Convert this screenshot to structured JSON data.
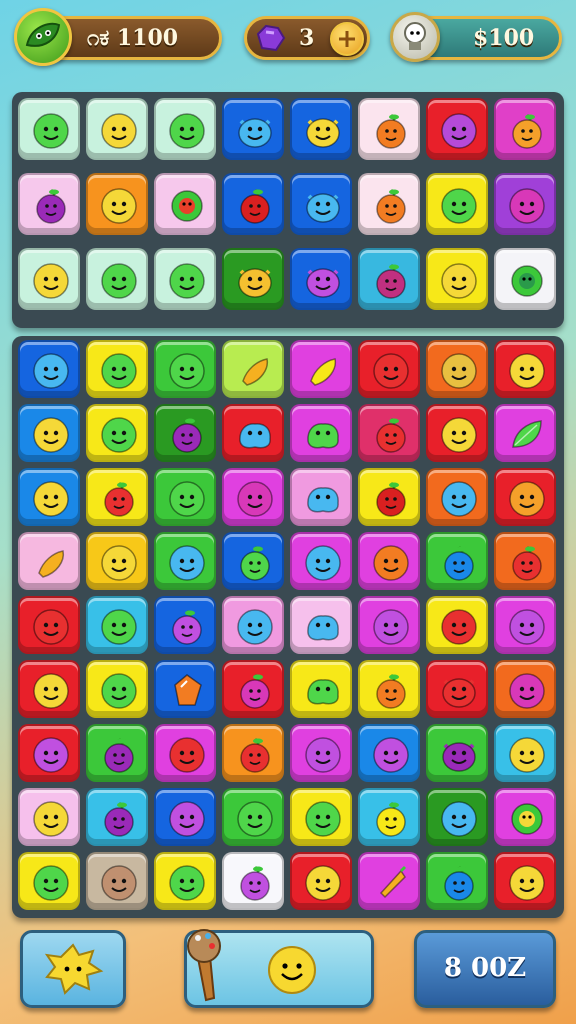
{
  "hud": {
    "coins_value": "೧ಕ 1100",
    "gems_value": "3",
    "score_value": "$100",
    "leaf_icon": "leaf-icon",
    "gem_icon": "purple-gem-icon",
    "plus_icon": "plus-icon",
    "bulb_icon": "lightbulb-icon"
  },
  "top_board": {
    "columns": 8,
    "tiles": [
      {
        "color": "#c8f2de",
        "face": "smiley",
        "fc": "#4fd64a"
      },
      {
        "color": "#c8f2de",
        "face": "smiley",
        "fc": "#f5d838"
      },
      {
        "color": "#c8f2de",
        "face": "smiley",
        "fc": "#4fd64a"
      },
      {
        "color": "#1565e0",
        "face": "monster",
        "fc": "#48b8f0"
      },
      {
        "color": "#1565e0",
        "face": "monster",
        "fc": "#f5d838"
      },
      {
        "color": "#fbe4ee",
        "face": "fruit",
        "fc": "#f27c22"
      },
      {
        "color": "#e8202a",
        "face": "smiley",
        "fc": "#b64ad8"
      },
      {
        "color": "#e040c8",
        "face": "fruit",
        "fc": "#f5a02a"
      },
      {
        "color": "#f6c8ec",
        "face": "fruit",
        "fc": "#9a2ab8"
      },
      {
        "color": "#f7931e",
        "face": "smiley",
        "fc": "#f5d838"
      },
      {
        "color": "#f6c8ec",
        "face": "flower",
        "fc": "#e8402a"
      },
      {
        "color": "#1565e0",
        "face": "fruit",
        "fc": "#d92020"
      },
      {
        "color": "#1565e0",
        "face": "monster",
        "fc": "#48b8f0"
      },
      {
        "color": "#fbe4ee",
        "face": "fruit",
        "fc": "#f27c22"
      },
      {
        "color": "#f7e818",
        "face": "smiley",
        "fc": "#4fd64a"
      },
      {
        "color": "#a040d8",
        "face": "smiley",
        "fc": "#d838b8"
      },
      {
        "color": "#c8f2de",
        "face": "smiley",
        "fc": "#f5d838"
      },
      {
        "color": "#c8f2de",
        "face": "smiley",
        "fc": "#4fd64a"
      },
      {
        "color": "#c8f2de",
        "face": "smiley",
        "fc": "#4fd64a"
      },
      {
        "color": "#2a9a22",
        "face": "monster",
        "fc": "#f5c030"
      },
      {
        "color": "#1565e0",
        "face": "monster",
        "fc": "#c050e0"
      },
      {
        "color": "#38b8e0",
        "face": "fruit",
        "fc": "#c03080"
      },
      {
        "color": "#f7e818",
        "face": "smiley",
        "fc": "#f5d838"
      },
      {
        "color": "#f4f4f8",
        "face": "flower",
        "fc": "#2a9a4a"
      }
    ]
  },
  "main_board": {
    "columns": 8,
    "tiles": [
      {
        "color": "#1565e0",
        "face": "smiley",
        "fc": "#48b8f0"
      },
      {
        "color": "#f7e818",
        "face": "smiley",
        "fc": "#4fd64a"
      },
      {
        "color": "#3cc83a",
        "face": "smiley",
        "fc": "#4fd64a"
      },
      {
        "color": "#b8ec50",
        "face": "banana",
        "fc": "#f5b020"
      },
      {
        "color": "#e040e0",
        "face": "banana",
        "fc": "#f7e818"
      },
      {
        "color": "#e8202a",
        "face": "smiley",
        "fc": "#e83030"
      },
      {
        "color": "#f26a1e",
        "face": "smiley",
        "fc": "#e8c040"
      },
      {
        "color": "#e8202a",
        "face": "smiley",
        "fc": "#f5d838"
      },
      {
        "color": "#1a88e8",
        "face": "smiley",
        "fc": "#f5d838"
      },
      {
        "color": "#f7e818",
        "face": "smiley",
        "fc": "#4fd64a"
      },
      {
        "color": "#2a9a22",
        "face": "fruit",
        "fc": "#9a2ab8"
      },
      {
        "color": "#e8202a",
        "face": "blob",
        "fc": "#48b8f0"
      },
      {
        "color": "#e040e0",
        "face": "blob",
        "fc": "#4fd64a"
      },
      {
        "color": "#e0306a",
        "face": "fruit",
        "fc": "#e83030"
      },
      {
        "color": "#e8202a",
        "face": "smiley",
        "fc": "#f5d838"
      },
      {
        "color": "#e040e0",
        "face": "leaf",
        "fc": "#4fd64a"
      },
      {
        "color": "#1a88e8",
        "face": "smiley",
        "fc": "#f5d838"
      },
      {
        "color": "#f7e818",
        "face": "fruit",
        "fc": "#e83030"
      },
      {
        "color": "#3cc83a",
        "face": "smiley",
        "fc": "#4fd64a"
      },
      {
        "color": "#e040e0",
        "face": "smiley",
        "fc": "#d838b8"
      },
      {
        "color": "#f09ae0",
        "face": "blob",
        "fc": "#48b8f0"
      },
      {
        "color": "#f7e818",
        "face": "fruit",
        "fc": "#d92020"
      },
      {
        "color": "#f26a1e",
        "face": "smiley",
        "fc": "#48b8f0"
      },
      {
        "color": "#e8202a",
        "face": "smiley",
        "fc": "#f5a02a"
      },
      {
        "color": "#f6b8e0",
        "face": "banana",
        "fc": "#f5b020"
      },
      {
        "color": "#f7c818",
        "face": "smiley",
        "fc": "#f5d838"
      },
      {
        "color": "#3cc83a",
        "face": "smiley",
        "fc": "#48b8f0"
      },
      {
        "color": "#1565e0",
        "face": "fruit",
        "fc": "#4fd64a"
      },
      {
        "color": "#e040e0",
        "face": "smiley",
        "fc": "#48b8f0"
      },
      {
        "color": "#e040e0",
        "face": "smiley",
        "fc": "#f27c22"
      },
      {
        "color": "#3cc83a",
        "face": "fruit",
        "fc": "#1a88e8"
      },
      {
        "color": "#f26a1e",
        "face": "fruit",
        "fc": "#e83030"
      },
      {
        "color": "#e8202a",
        "face": "smiley",
        "fc": "#e83030"
      },
      {
        "color": "#38c0e8",
        "face": "smiley",
        "fc": "#4fd64a"
      },
      {
        "color": "#1565e0",
        "face": "fruit",
        "fc": "#c050e0"
      },
      {
        "color": "#f09ae0",
        "face": "smiley",
        "fc": "#48b8f0"
      },
      {
        "color": "#f6c0ec",
        "face": "blob",
        "fc": "#48b8f0"
      },
      {
        "color": "#e040e0",
        "face": "smiley",
        "fc": "#c050e0"
      },
      {
        "color": "#f7e818",
        "face": "smiley",
        "fc": "#e83030"
      },
      {
        "color": "#e040e0",
        "face": "smiley",
        "fc": "#c050e0"
      },
      {
        "color": "#e8202a",
        "face": "smiley",
        "fc": "#f5d838"
      },
      {
        "color": "#f7e818",
        "face": "smiley",
        "fc": "#4fd64a"
      },
      {
        "color": "#1565e0",
        "face": "gem",
        "fc": "#f27c22"
      },
      {
        "color": "#e8202a",
        "face": "fruit",
        "fc": "#d838b8"
      },
      {
        "color": "#f7e818",
        "face": "blob",
        "fc": "#4fd64a"
      },
      {
        "color": "#f7e818",
        "face": "fruit",
        "fc": "#f27c22"
      },
      {
        "color": "#e8202a",
        "face": "monster",
        "fc": "#e83030"
      },
      {
        "color": "#f26a1e",
        "face": "smiley",
        "fc": "#d838b8"
      },
      {
        "color": "#e8202a",
        "face": "smiley",
        "fc": "#c050e0"
      },
      {
        "color": "#3cc83a",
        "face": "fruit",
        "fc": "#9a2ab8"
      },
      {
        "color": "#e040e0",
        "face": "smiley",
        "fc": "#e83030"
      },
      {
        "color": "#f7931e",
        "face": "fruit",
        "fc": "#e83030"
      },
      {
        "color": "#e040e0",
        "face": "smiley",
        "fc": "#c050e0"
      },
      {
        "color": "#1a88e8",
        "face": "smiley",
        "fc": "#c050e0"
      },
      {
        "color": "#3cc83a",
        "face": "monster",
        "fc": "#9a2ab8"
      },
      {
        "color": "#38c0e8",
        "face": "smiley",
        "fc": "#f5d838"
      },
      {
        "color": "#f6c0ec",
        "face": "smiley",
        "fc": "#f5d838"
      },
      {
        "color": "#38c0e8",
        "face": "fruit",
        "fc": "#9a2ab8"
      },
      {
        "color": "#1565e0",
        "face": "smiley",
        "fc": "#c050e0"
      },
      {
        "color": "#3cc83a",
        "face": "smiley",
        "fc": "#4fd64a"
      },
      {
        "color": "#f7e818",
        "face": "smiley",
        "fc": "#4fd64a"
      },
      {
        "color": "#38c0e8",
        "face": "fruit",
        "fc": "#f7e818"
      },
      {
        "color": "#2a9a22",
        "face": "smiley",
        "fc": "#48b8f0"
      },
      {
        "color": "#e040e0",
        "face": "flower",
        "fc": "#f5d838"
      },
      {
        "color": "#f7e818",
        "face": "smiley",
        "fc": "#4fd64a"
      },
      {
        "color": "#c8b8a0",
        "face": "smiley",
        "fc": "#c09070"
      },
      {
        "color": "#f7e818",
        "face": "smiley",
        "fc": "#4fd64a"
      },
      {
        "color": "#f8f8fc",
        "face": "fruit",
        "fc": "#c050e0"
      },
      {
        "color": "#e8202a",
        "face": "smiley",
        "fc": "#f5d838"
      },
      {
        "color": "#e040e0",
        "face": "carrot",
        "fc": "#f5b020"
      },
      {
        "color": "#3cc83a",
        "face": "fruit",
        "fc": "#1a88e8"
      },
      {
        "color": "#e8202a",
        "face": "smiley",
        "fc": "#f5d838"
      }
    ]
  },
  "bottom": {
    "booster_icon": "star-blob-icon",
    "hammer_icon": "ice-cream-hammer-icon",
    "target_icon": "smiley-target-icon",
    "moves_value": "8 00Z"
  }
}
